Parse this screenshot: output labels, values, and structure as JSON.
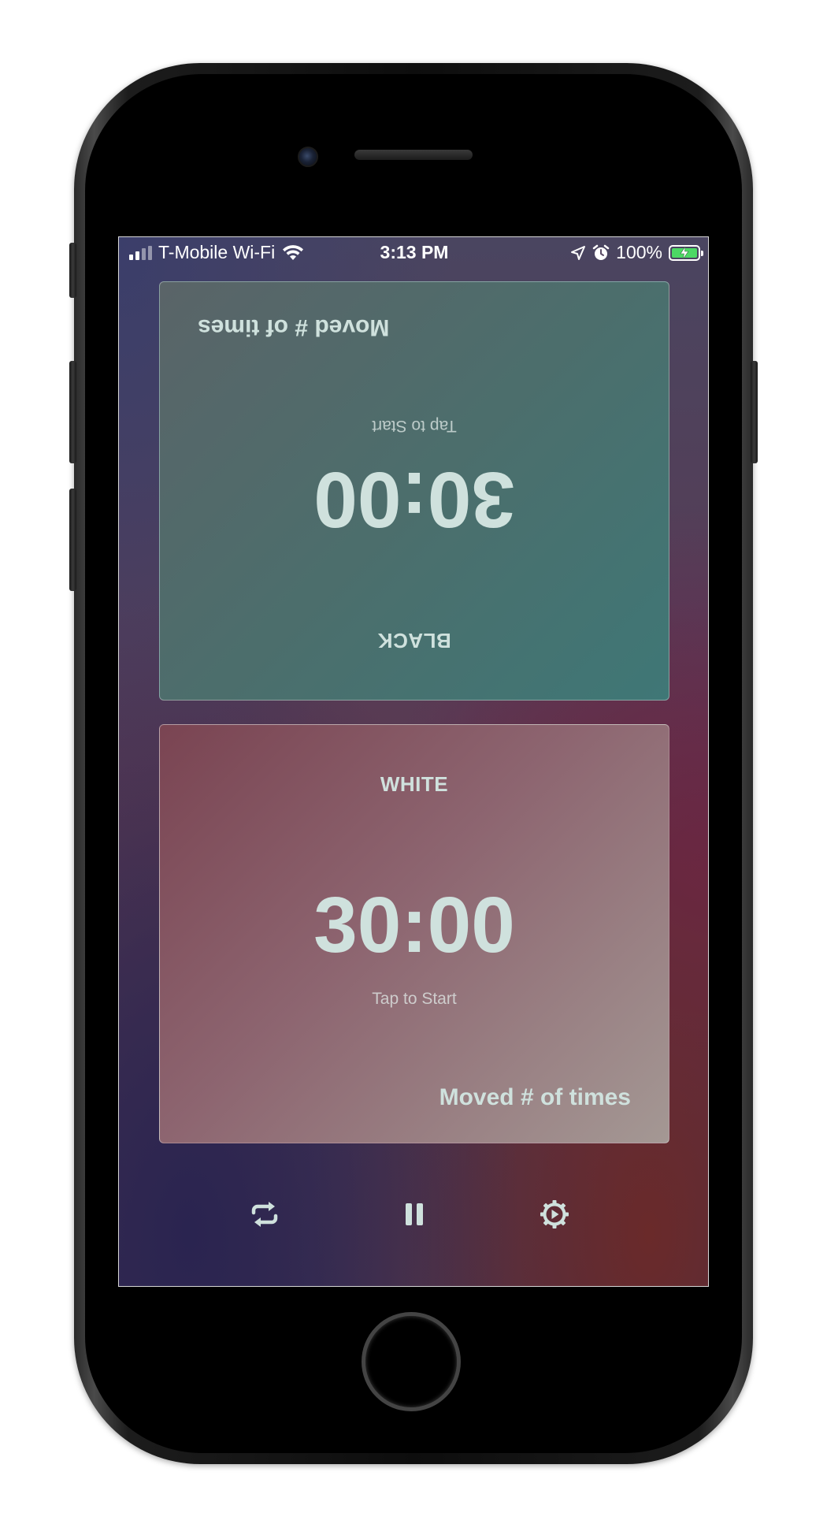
{
  "status_bar": {
    "carrier": "T-Mobile Wi-Fi",
    "time": "3:13 PM",
    "battery_percent": "100%",
    "signal_bars_filled": 2,
    "signal_bars_total": 4,
    "icons": [
      "wifi-icon",
      "location-arrow-icon",
      "alarm-icon",
      "battery-charging-icon"
    ]
  },
  "black_player": {
    "label": "BLACK",
    "timer": "30:00",
    "hint": "Tap to Start",
    "moves_label": "Moved # of times",
    "orientation": "upside-down"
  },
  "white_player": {
    "label": "WHITE",
    "timer": "30:00",
    "hint": "Tap to Start",
    "moves_label": "Moved # of times"
  },
  "toolbar": {
    "buttons": [
      {
        "icon": "repeat-icon",
        "action": "restart"
      },
      {
        "icon": "pause-icon",
        "action": "pause"
      },
      {
        "icon": "settings-gear-icon",
        "action": "settings"
      }
    ]
  },
  "colors": {
    "text_accent": "#cfe1dd",
    "black_card": "#4c6e6c",
    "white_card": "#8d6570",
    "battery_green": "#4cd964"
  }
}
